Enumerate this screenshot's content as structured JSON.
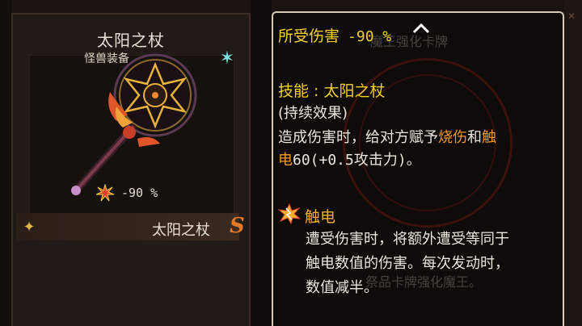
{
  "card": {
    "title": "太阳之杖",
    "subtitle": "怪兽装备",
    "stat": "-90 %",
    "name": "太阳之杖",
    "rank": "S",
    "icons": [
      "star-icon",
      "burst-icon",
      "sparkle-icon"
    ]
  },
  "tooltip": {
    "top_label": "所受伤害",
    "top_value": "-90 %",
    "watermark_top": "魔王强化卡牌",
    "skill_prefix": "技能 : ",
    "skill_name": "太阳之杖",
    "effect_type": "(持续效果)",
    "desc1_a": "造成伤害时，给对方赋予",
    "desc1_hl1": "烧伤",
    "desc1_b": "和",
    "desc1_hl2": "触",
    "desc2_hl": "电",
    "desc2_rest": "60(+0.5攻击力)。",
    "status_title": "触电",
    "status_line1": "遭受伤害时，将额外遭受等同于",
    "status_line2": "触电数值的伤害。每次发动时，",
    "status_line3": "数值减半。",
    "watermark_bottom": "祭品卡牌强化魔王。",
    "colors": {
      "yellow": "#f2d027",
      "orange": "#ef9a2b"
    }
  }
}
